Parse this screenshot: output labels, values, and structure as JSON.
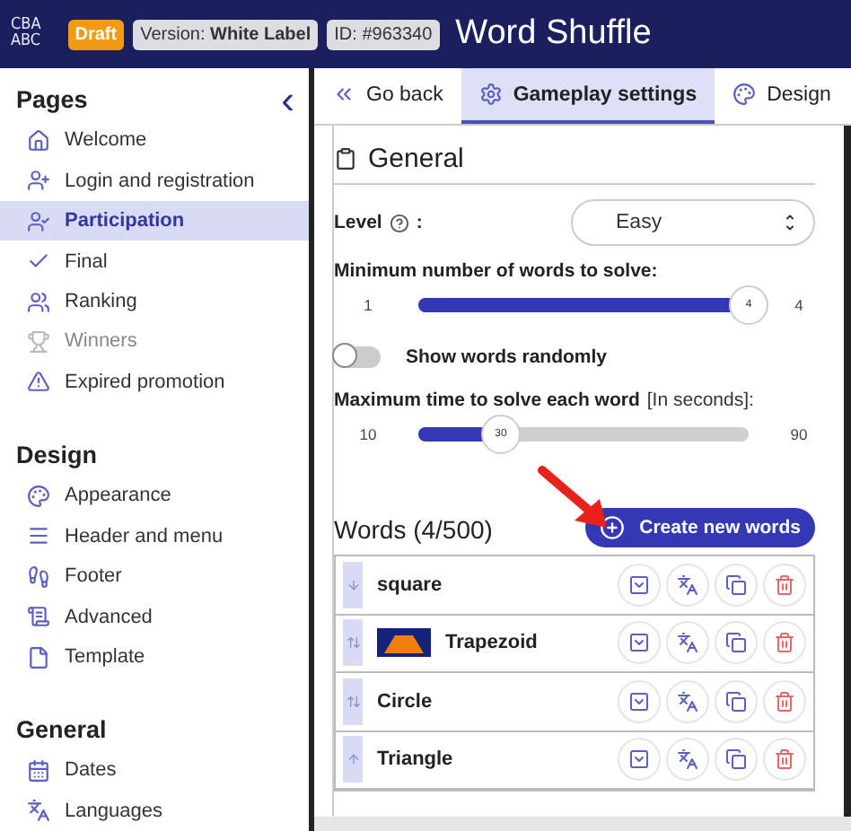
{
  "header": {
    "logo": [
      "CBA",
      "ABC"
    ],
    "status": "Draft",
    "version_label": "Version:",
    "version": "White Label",
    "id": "ID: #963340",
    "title": "Word Shuffle"
  },
  "sidebar": {
    "sections": [
      {
        "title": "Pages",
        "collapse": "‹",
        "items": [
          {
            "label": "Welcome",
            "selected": false,
            "disabled": false
          },
          {
            "label": "Login and registration",
            "selected": false,
            "disabled": false
          },
          {
            "label": "Participation",
            "selected": true,
            "disabled": false
          },
          {
            "label": "Final",
            "selected": false,
            "disabled": false
          },
          {
            "label": "Ranking",
            "selected": false,
            "disabled": false
          },
          {
            "label": "Winners",
            "selected": false,
            "disabled": true
          },
          {
            "label": "Expired promotion",
            "selected": false,
            "disabled": false
          }
        ]
      },
      {
        "title": "Design",
        "items": [
          {
            "label": "Appearance",
            "selected": false,
            "disabled": false
          },
          {
            "label": "Header and menu",
            "selected": false,
            "disabled": false
          },
          {
            "label": "Footer",
            "selected": false,
            "disabled": false
          },
          {
            "label": "Advanced",
            "selected": false,
            "disabled": false
          },
          {
            "label": "Template",
            "selected": false,
            "disabled": false
          }
        ]
      },
      {
        "title": "General",
        "items": [
          {
            "label": "Dates",
            "selected": false,
            "disabled": false
          },
          {
            "label": "Languages",
            "selected": false,
            "disabled": false
          }
        ]
      }
    ]
  },
  "tabs": [
    {
      "label": "Go back",
      "selected": false
    },
    {
      "label": "Gameplay settings",
      "selected": true
    },
    {
      "label": "Design",
      "selected": false
    }
  ],
  "general": {
    "title": "General",
    "level": {
      "label": "Level",
      "suffix": ":",
      "value": "Easy"
    },
    "min_words": {
      "label": "Minimum number of words to solve:",
      "min": "1",
      "max": "4",
      "value": "4",
      "level": 1
    },
    "random": {
      "label": "Show words randomly",
      "on": false
    },
    "max_time": {
      "label": "Maximum time to solve each word",
      "hint": "[In seconds]:",
      "min": "10",
      "max": "90",
      "value": "30",
      "level": 0.25
    }
  },
  "words": {
    "title": "Words (4/500)",
    "create_button": "Create new words",
    "rows": [
      {
        "word": "square",
        "kind": "text"
      },
      {
        "word": "Trapezoid",
        "kind": "picture"
      },
      {
        "word": "Circle",
        "kind": "text"
      },
      {
        "word": "Triangle",
        "kind": "text"
      }
    ]
  }
}
